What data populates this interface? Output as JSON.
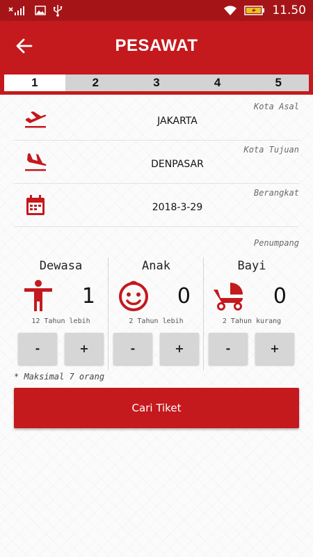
{
  "status_bar": {
    "time": "11.50"
  },
  "app_bar": {
    "title": "PESAWAT"
  },
  "steps": [
    "1",
    "2",
    "3",
    "4",
    "5"
  ],
  "form": {
    "origin": {
      "label": "Kota Asal",
      "value": "JAKARTA",
      "icon": "flight-takeoff-icon"
    },
    "destination": {
      "label": "Kota Tujuan",
      "value": "DENPASAR",
      "icon": "flight-land-icon"
    },
    "departure": {
      "label": "Berangkat",
      "value": "2018-3-29",
      "icon": "calendar-icon"
    }
  },
  "passengers": {
    "label": "Penumpang",
    "adult": {
      "title": "Dewasa",
      "count": "1",
      "note": "12 Tahun lebih",
      "minus": "-",
      "plus": "+"
    },
    "child": {
      "title": "Anak",
      "count": "0",
      "note": "2 Tahun lebih",
      "minus": "-",
      "plus": "+"
    },
    "infant": {
      "title": "Bayi",
      "count": "0",
      "note": "2 Tahun kurang",
      "minus": "-",
      "plus": "+"
    },
    "max_note": "* Maksimal 7 orang"
  },
  "search_button": "Cari Tiket",
  "colors": {
    "primary": "#c4191d",
    "status_bar": "#a51518",
    "step_bg": "#d3d3d3"
  }
}
